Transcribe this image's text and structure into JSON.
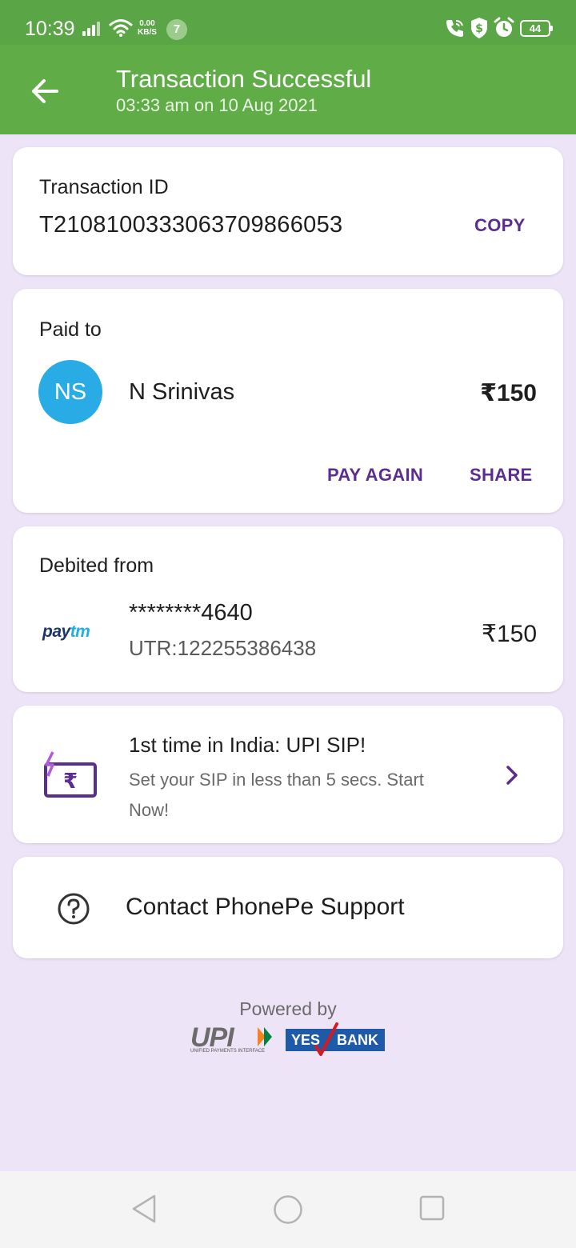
{
  "status_bar": {
    "time": "10:39",
    "net_speed_top": "0.00",
    "net_speed_bottom": "KB/S",
    "notification_count": "7",
    "battery": "44"
  },
  "header": {
    "title": "Transaction Successful",
    "subtitle": "03:33 am on 10 Aug 2021",
    "background_color": "#60ac47"
  },
  "transaction": {
    "label": "Transaction ID",
    "id": "T2108100333063709866053",
    "copy_label": "COPY"
  },
  "paid_to": {
    "label": "Paid to",
    "avatar_initials": "NS",
    "name": "N Srinivas",
    "amount": "₹150",
    "pay_again_label": "PAY AGAIN",
    "share_label": "SHARE"
  },
  "debited_from": {
    "label": "Debited from",
    "bank_logo_pay": "pay",
    "bank_logo_tm": "tm",
    "account_masked": "********4640",
    "utr": "UTR:122255386438",
    "amount": "₹150"
  },
  "promo": {
    "icon": "upi-sip-icon",
    "title": "1st time in India: UPI SIP!",
    "description": "Set your SIP in less than 5 secs. Start Now!"
  },
  "support": {
    "icon": "help-circle-icon",
    "label": "Contact PhonePe Support"
  },
  "footer": {
    "powered_by": "Powered by",
    "upi_word": "UPI",
    "upi_sub": "UNIFIED PAYMENTS INTERFACE",
    "yes_word": "YES",
    "bank_word": "BANK"
  },
  "colors": {
    "accent": "#5b2d91",
    "avatar": "#29abe6",
    "page_background": "#ede5f7"
  }
}
